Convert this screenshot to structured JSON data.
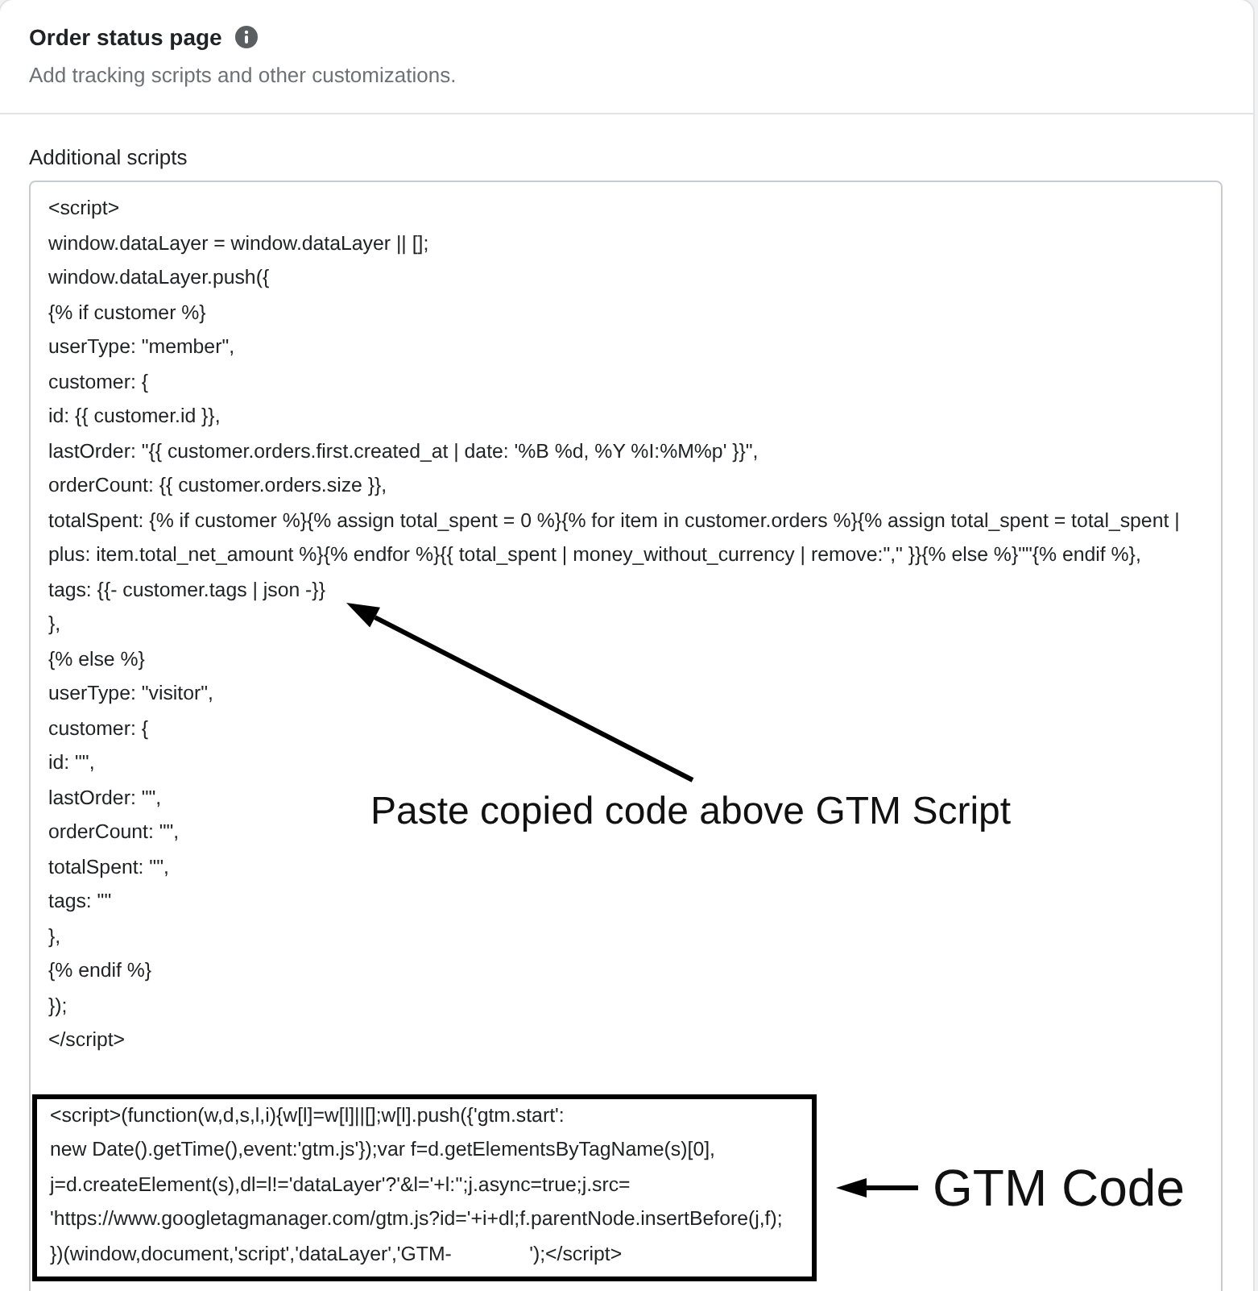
{
  "section": {
    "title": "Order status page",
    "subtitle": "Add tracking scripts and other customizations."
  },
  "editor": {
    "label": "Additional scripts",
    "lines": [
      "<script>",
      "window.dataLayer = window.dataLayer || [];",
      "window.dataLayer.push({",
      "{% if customer %}",
      "userType: \"member\",",
      "customer: {",
      "id: {{ customer.id }},",
      "lastOrder: \"{{ customer.orders.first.created_at | date: '%B %d, %Y %I:%M%p' }}\",",
      "orderCount: {{ customer.orders.size }},",
      "totalSpent: {% if customer %}{% assign total_spent = 0 %}{% for item in customer.orders %}{% assign total_spent = total_spent |",
      "plus: item.total_net_amount %}{% endfor %}{{ total_spent | money_without_currency | remove:\",\" }}{% else %}\"\"{% endif %},",
      "tags: {{- customer.tags | json -}}",
      "},",
      "{% else %}",
      "userType: \"visitor\",",
      "customer: {",
      "id: \"\",",
      "lastOrder: \"\",",
      "orderCount: \"\",",
      "totalSpent: \"\",",
      "tags: \"\"",
      "},",
      "{% endif %}",
      "});",
      "</script>"
    ],
    "callout": {
      "kind": "diagonal_arrow",
      "text": "Paste copied code above GTM Script"
    },
    "highlight": {
      "lines": [
        "<script>(function(w,d,s,l,i){w[l]=w[l]||[];w[l].push({'gtm.start':",
        "new Date().getTime(),event:'gtm.js'});var f=d.getElementsByTagName(s)[0],",
        "j=d.createElement(s),dl=l!='dataLayer'?'&l='+l:'';j.async=true;j.src=",
        "'https://www.googletagmanager.com/gtm.js?id='+i+dl;f.parentNode.insertBefore(j,f);",
        "})(window,document,'script','dataLayer','GTM-              ');</script>"
      ],
      "callout": {
        "kind": "left_arrow",
        "text": "GTM Code"
      }
    }
  }
}
